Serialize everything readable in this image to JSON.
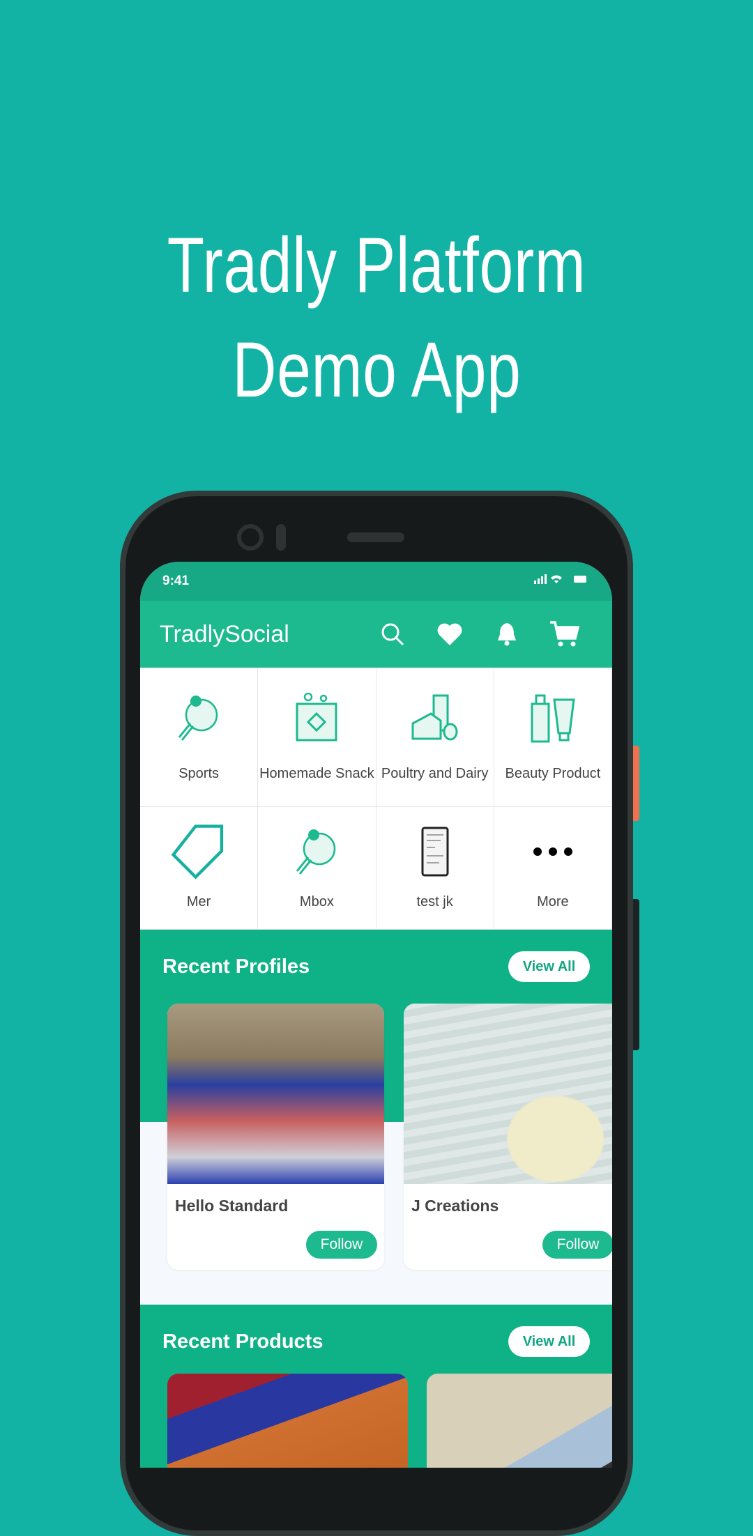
{
  "hero": {
    "line1": "Tradly Platform",
    "line2": "Demo App"
  },
  "status": {
    "time": "9:41"
  },
  "appbar": {
    "title": "TradlySocial",
    "icons": [
      "search-icon",
      "heart-icon",
      "bell-icon",
      "cart-icon"
    ]
  },
  "categories": [
    {
      "label": "Sports",
      "icon": "ping-pong-icon"
    },
    {
      "label": "Homemade Snack",
      "icon": "snack-bag-icon"
    },
    {
      "label": "Poultry and Dairy",
      "icon": "dairy-icon"
    },
    {
      "label": "Beauty Product",
      "icon": "cosmetics-icon"
    },
    {
      "label": "Mer",
      "icon": "tag-icon"
    },
    {
      "label": "Mbox",
      "icon": "ping-pong-icon"
    },
    {
      "label": "test jk",
      "icon": "phone-thumbnail-icon"
    },
    {
      "label": "More",
      "icon": "more-dots-icon"
    }
  ],
  "profiles": {
    "title": "Recent Profiles",
    "view_all": "View All",
    "items": [
      {
        "name": "Hello Standard",
        "follow": "Follow"
      },
      {
        "name": "J Creations",
        "follow": "Follow"
      }
    ]
  },
  "products": {
    "title": "Recent Products",
    "view_all": "View All"
  },
  "colors": {
    "background": "#12b3a5",
    "primary": "#1db98f",
    "accent_side_button": "#f07050"
  }
}
